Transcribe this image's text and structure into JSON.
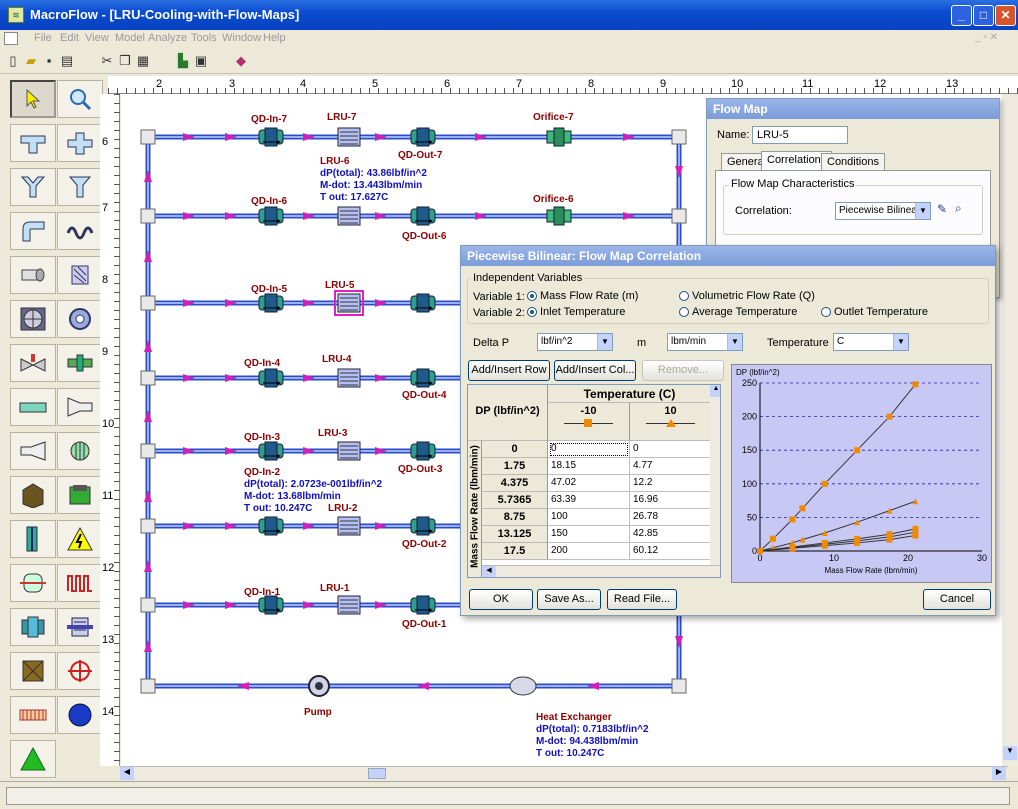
{
  "window": {
    "title": "MacroFlow - [LRU-Cooling-with-Flow-Maps]"
  },
  "menu": [
    "File",
    "Edit",
    "View",
    "Model",
    "Analyze",
    "Tools",
    "Window",
    "Help"
  ],
  "ruler_top": [
    "2",
    "3",
    "4",
    "5",
    "6",
    "7",
    "8",
    "9",
    "10",
    "11",
    "12",
    "13"
  ],
  "ruler_left": [
    "6",
    "7",
    "8",
    "9",
    "10",
    "11",
    "12",
    "13",
    "14"
  ],
  "diagram": {
    "components": [
      {
        "kind": "qdin",
        "label": "QD-In-7"
      },
      {
        "kind": "lru",
        "label": "LRU-7"
      },
      {
        "kind": "qdout",
        "label": "QD-Out-7"
      },
      {
        "kind": "orifice",
        "label": "Orifice-7"
      },
      {
        "kind": "qdin",
        "label": "QD-In-6"
      },
      {
        "kind": "lru",
        "label": "LRU-6"
      },
      {
        "kind": "qdout",
        "label": "QD-Out-6"
      },
      {
        "kind": "orifice",
        "label": "Orifice-6"
      },
      {
        "kind": "qdin",
        "label": "QD-In-5"
      },
      {
        "kind": "lru",
        "label": "LRU-5"
      },
      {
        "kind": "qdin",
        "label": "QD-In-4"
      },
      {
        "kind": "lru",
        "label": "LRU-4"
      },
      {
        "kind": "qdout",
        "label": "QD-Out-4"
      },
      {
        "kind": "qdin",
        "label": "QD-In-3"
      },
      {
        "kind": "lru",
        "label": "LRU-3"
      },
      {
        "kind": "qdout",
        "label": "QD-Out-3"
      },
      {
        "kind": "qdin",
        "label": "QD-In-2"
      },
      {
        "kind": "lru",
        "label": "LRU-2"
      },
      {
        "kind": "qdout",
        "label": "QD-Out-2"
      },
      {
        "kind": "qdin",
        "label": "QD-In-1"
      },
      {
        "kind": "lru",
        "label": "LRU-1"
      },
      {
        "kind": "qdout",
        "label": "QD-Out-1"
      },
      {
        "kind": "pump",
        "label": "Pump"
      },
      {
        "kind": "hx",
        "label": "Heat Exchanger"
      }
    ],
    "results": [
      {
        "name": "LRU-6",
        "lines": [
          "dP(total): 43.86lbf/in^2",
          "M-dot: 13.443lbm/min",
          "T out: 17.627C"
        ]
      },
      {
        "name": "QD-In-2",
        "lines": [
          "dP(total): 2.0723e-001lbf/in^2",
          "M-dot: 13.68lbm/min",
          "T out: 10.247C"
        ]
      },
      {
        "name": "Heat Exchanger",
        "lines": [
          "dP(total): 0.7183lbf/in^2",
          "M-dot: 94.438lbm/min",
          "T out: 10.247C"
        ]
      }
    ]
  },
  "flow_map": {
    "title": "Flow Map",
    "name_label": "Name:",
    "name_value": "LRU-5",
    "tabs": [
      "General",
      "Correlations",
      "Conditions"
    ],
    "active_tab": "Correlations",
    "group_label": "Flow Map Characteristics",
    "correlation_label": "Correlation:",
    "correlation_value": "Piecewise Bilinear"
  },
  "pb_dialog": {
    "title": "Piecewise Bilinear: Flow Map Correlation",
    "group_label": "Independent Variables",
    "var1_label": "Variable 1:",
    "var2_label": "Variable 2:",
    "var1_opt1": "Mass Flow Rate (m)",
    "var1_opt2": "Volumetric Flow Rate (Q)",
    "var2_opt1": "Inlet Temperature",
    "var2_opt2": "Average Temperature",
    "var2_opt3": "Outlet Temperature",
    "deltap_label": "Delta P",
    "deltap_unit": "lbf/in^2",
    "m_label": "m",
    "m_unit": "lbm/min",
    "temp_label": "Temperature",
    "temp_unit": "C",
    "add_row": "Add/Insert Row",
    "add_col": "Add/Insert Col...",
    "remove": "Remove...",
    "ok": "OK",
    "save_as": "Save As...",
    "read_file": "Read File...",
    "cancel": "Cancel"
  },
  "grid": {
    "corner_label": "DP (lbf/in^2)",
    "temp_header": "Temperature (C)",
    "side_label": "Mass Flow Rate (lbm/min)",
    "columns": [
      "-10",
      "10"
    ],
    "rows": [
      {
        "m": "0",
        "c1": "0",
        "c2": "0"
      },
      {
        "m": "1.75",
        "c1": "18.15",
        "c2": "4.77"
      },
      {
        "m": "4.375",
        "c1": "47.02",
        "c2": "12.2"
      },
      {
        "m": "5.7365",
        "c1": "63.39",
        "c2": "16.96"
      },
      {
        "m": "8.75",
        "c1": "100",
        "c2": "26.78"
      },
      {
        "m": "13.125",
        "c1": "150",
        "c2": "42.85"
      },
      {
        "m": "17.5",
        "c1": "200",
        "c2": "60.12"
      }
    ]
  },
  "chart_data": {
    "type": "line",
    "ylabel": "DP (lbf/in^2)",
    "xlabel": "Mass Flow Rate (lbm/min)",
    "xlim": [
      0,
      30
    ],
    "ylim": [
      0,
      250
    ],
    "xticks": [
      0,
      10,
      20,
      30
    ],
    "yticks": [
      0,
      50,
      100,
      150,
      200,
      250
    ],
    "grid": true,
    "series": [
      {
        "x": [
          0,
          1.75,
          4.375,
          5.7365,
          8.75,
          13.125,
          17.5,
          21
        ],
        "y": [
          0,
          18.15,
          47.02,
          63.39,
          100,
          150,
          200,
          248
        ]
      },
      {
        "x": [
          0,
          1.75,
          4.375,
          5.7365,
          8.75,
          13.125,
          17.5,
          21
        ],
        "y": [
          0,
          4.77,
          12.2,
          16.96,
          26.78,
          42.85,
          60.12,
          74
        ]
      },
      {
        "x": [
          0,
          4.375,
          8.75,
          13.125,
          17.5,
          21
        ],
        "y": [
          0,
          6,
          12,
          18,
          25,
          33
        ]
      },
      {
        "x": [
          0,
          4.375,
          8.75,
          13.125,
          17.5,
          21
        ],
        "y": [
          0,
          5,
          10,
          15,
          21,
          28
        ]
      },
      {
        "x": [
          0,
          4.375,
          8.75,
          13.125,
          17.5,
          21
        ],
        "y": [
          0,
          4,
          8,
          12,
          17,
          23
        ]
      }
    ],
    "colors": {
      "line": "#333333",
      "marker": "#f08a00",
      "grid": "#2222aa"
    }
  }
}
